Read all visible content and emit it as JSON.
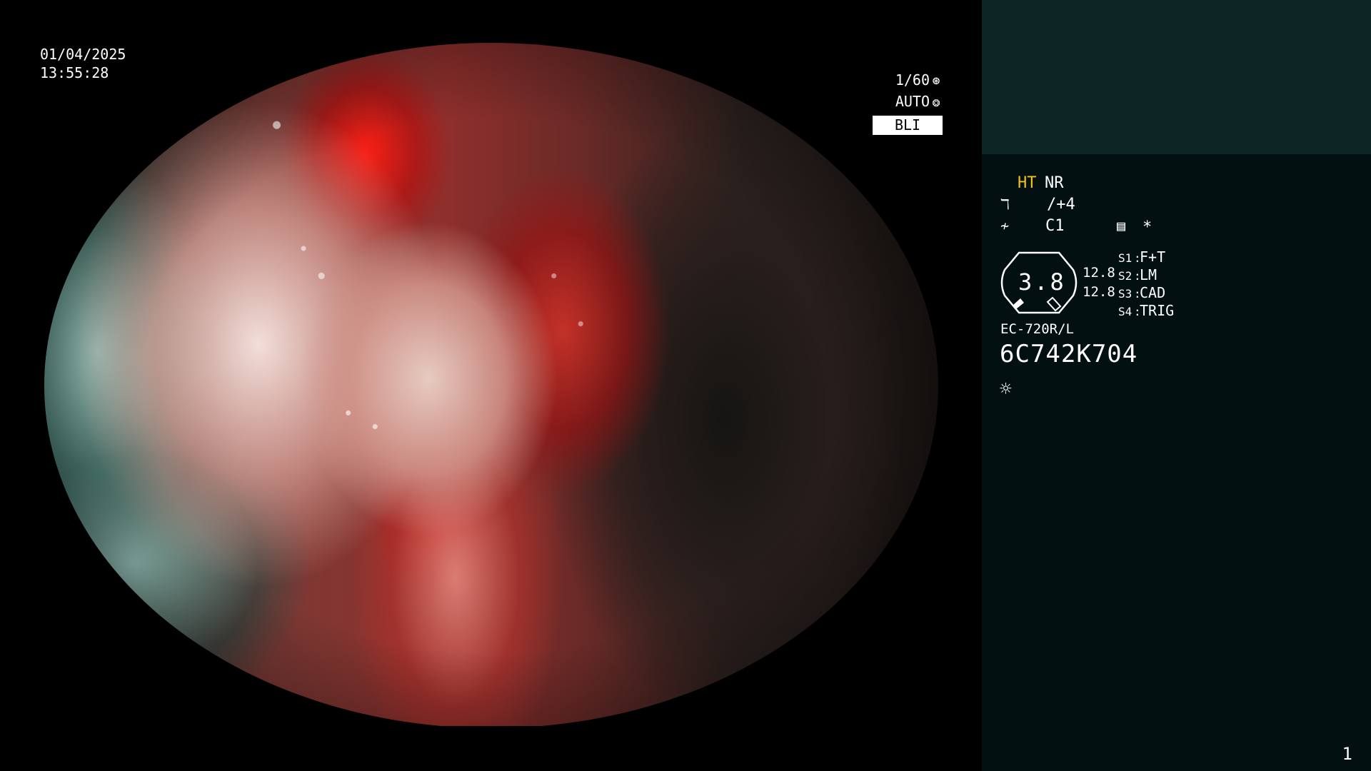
{
  "overlay": {
    "date": "01/04/2025",
    "time": "13:55:28",
    "shutter": "1/60",
    "shutter_icon": "aperture-icon",
    "exposure_mode": "AUTO",
    "exposure_icon": "iris-icon",
    "mode_label": "BLI"
  },
  "panel": {
    "ht": "HT",
    "nr": "NR",
    "enhance_value": "/+4",
    "enhance_icon": "structure-enhance-icon",
    "color_value": "C1",
    "color_icon": "color-mode-icon",
    "menu_icon": "settings-list-icon",
    "asterisk": "*",
    "gauge_value": "3.8",
    "scale_1": "12.8",
    "scale_2": "12.8",
    "switches": [
      {
        "key": "S1",
        "value": "F+T"
      },
      {
        "key": "S2",
        "value": "LM"
      },
      {
        "key": "S3",
        "value": "CAD"
      },
      {
        "key": "S4",
        "value": "TRIG"
      }
    ],
    "model": "EC-720R/L",
    "serial": "6C742K704",
    "light_icon": "sun-icon",
    "page_number": "1"
  },
  "colors": {
    "panel_top": "#0e2526",
    "panel_main": "#031012",
    "accent_yellow": "#f2c21b"
  }
}
